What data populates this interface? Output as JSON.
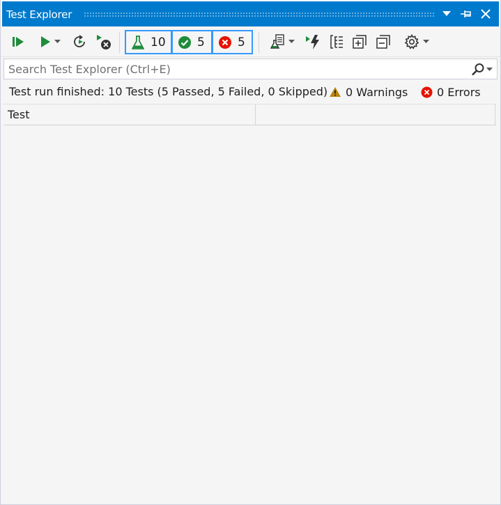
{
  "window": {
    "title": "Test Explorer"
  },
  "toolbar": {
    "run_all_icon": "run-all-icon",
    "run_icon": "run-icon",
    "rerun_icon": "rerun-failed-icon",
    "cancel_icon": "cancel-icon",
    "counters": {
      "total": "10",
      "passed": "5",
      "failed": "5"
    }
  },
  "search": {
    "placeholder": "Search Test Explorer (Ctrl+E)"
  },
  "status": {
    "summary": "Test run finished: 10 Tests (5 Passed, 5 Failed, 0 Skipped)",
    "warnings": "0 Warnings",
    "errors": "0 Errors"
  },
  "grid": {
    "columns": [
      "Test",
      ""
    ]
  },
  "colors": {
    "accent": "#007acc",
    "pass": "#1e8c3a",
    "fail": "#e51400",
    "warning": "#b8860b",
    "highlight_border": "#3399ff"
  }
}
